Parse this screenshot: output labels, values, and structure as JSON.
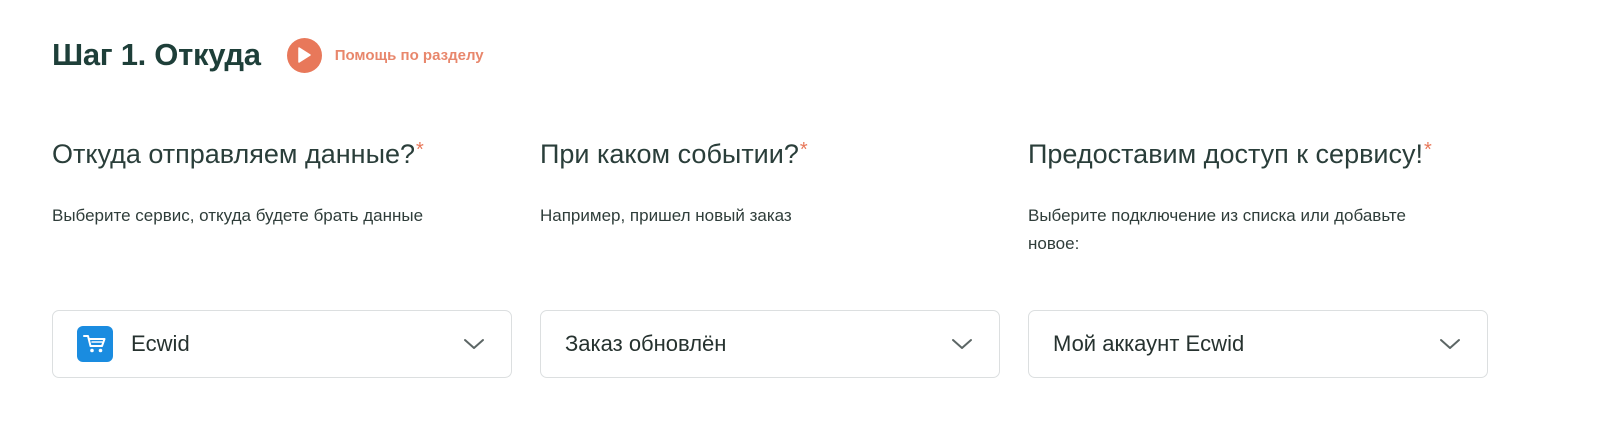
{
  "header": {
    "title": "Шаг 1. Откуда",
    "help_label": "Помощь по разделу",
    "help_icon": "play-icon",
    "accent_color": "#e8785a"
  },
  "columns": [
    {
      "question": "Откуда отправляем данные?",
      "required_mark": "*",
      "hint": "Выберите сервис, откуда будете брать данные",
      "select_value": "Ecwid",
      "select_icon": "ecwid-cart-icon"
    },
    {
      "question": "При каком событии?",
      "required_mark": "*",
      "hint": "Например, пришел новый заказ",
      "select_value": "Заказ обновлён"
    },
    {
      "question": "Предоставим доступ к сервису!",
      "required_mark": "*",
      "hint": "Выберите подключение из списка или добавьте новое:",
      "select_value": "Мой аккаунт Ecwid"
    }
  ],
  "colors": {
    "title": "#1e3f39",
    "accent": "#e8785a",
    "ecwid_brand": "#1a8ce0",
    "border": "#dcdfe0"
  }
}
